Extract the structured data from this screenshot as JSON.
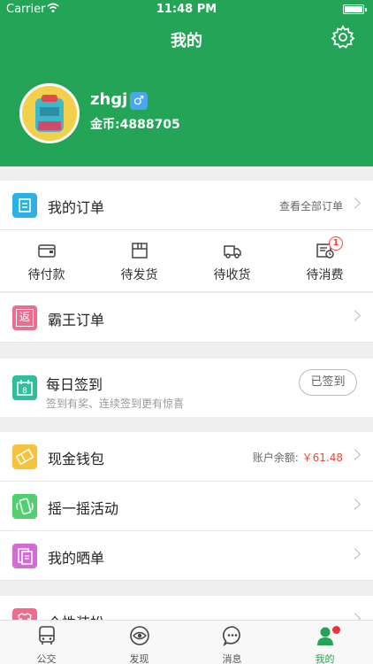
{
  "status": {
    "carrier": "Carrier",
    "time": "11:48 PM"
  },
  "header": {
    "title": "我的"
  },
  "profile": {
    "username": "zhgj",
    "gender_symbol": "♂",
    "coins": "金币:4888705"
  },
  "orders": {
    "title": "我的订单",
    "view_all": "查看全部订单",
    "tabs": [
      {
        "label": "待付款",
        "icon": "wallet-icon"
      },
      {
        "label": "待发货",
        "icon": "box-icon"
      },
      {
        "label": "待收货",
        "icon": "truck-icon"
      },
      {
        "label": "待消费",
        "icon": "ticket-icon",
        "badge": "1"
      }
    ]
  },
  "bawang": {
    "label": "霸王订单",
    "icon_char": "返"
  },
  "signin": {
    "title": "每日签到",
    "subtitle": "签到有奖、连续签到更有惊喜",
    "button": "已签到",
    "icon_char": "8"
  },
  "wallet": {
    "label": "现金钱包",
    "balance_label": "账户余额:",
    "balance_value": "￥61.48"
  },
  "shake": {
    "label": "摇一摇活动"
  },
  "share": {
    "label": "我的晒单"
  },
  "dressup": {
    "label": "个性装扮"
  },
  "tabbar": [
    {
      "label": "公交",
      "icon": "bus-icon"
    },
    {
      "label": "发现",
      "icon": "eye-icon"
    },
    {
      "label": "消息",
      "icon": "chat-icon"
    },
    {
      "label": "我的",
      "icon": "person-icon"
    }
  ],
  "colors": {
    "brand_green": "#23a456",
    "alert_red": "#e94a3a",
    "orders_blue": "#2bb1e6",
    "bawang_pink": "#f06c8e",
    "signin_teal": "#2fbf9a",
    "wallet_yellow": "#f5c23a",
    "shake_green": "#4fcf6e",
    "share_purple": "#d46ad6"
  }
}
